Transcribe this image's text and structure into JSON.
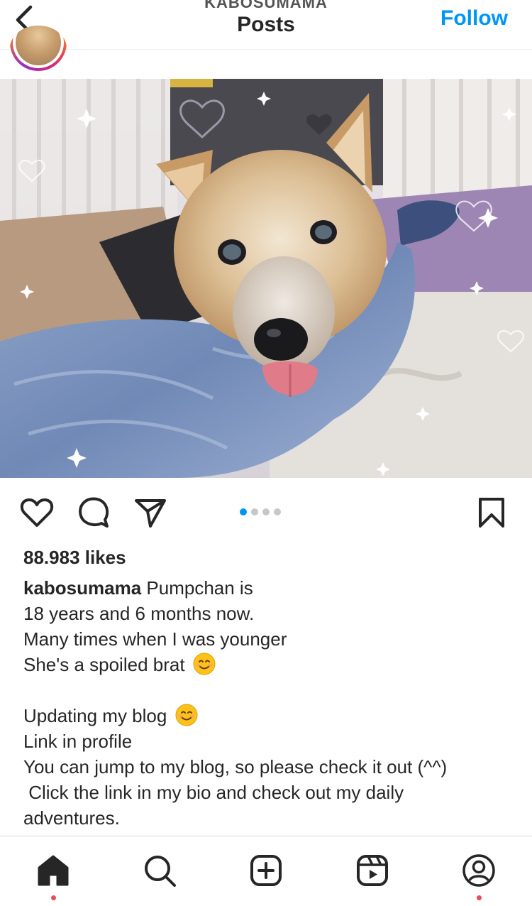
{
  "header": {
    "account_name": "KABOSUMAMA",
    "title": "Posts",
    "follow_label": "Follow",
    "back_icon": "chevron-left-icon"
  },
  "post": {
    "photo_description_icon": "post-photo",
    "carousel": {
      "total": 4,
      "active_index": 0
    },
    "actions": {
      "like_icon": "heart-icon",
      "comment_icon": "comment-icon",
      "share_icon": "share-icon",
      "save_icon": "bookmark-icon"
    },
    "likes": "88.983 likes",
    "caption": {
      "username": "kabosumama",
      "line1_text": " Pumpchan is",
      "line2": "18 years and 6 months now.",
      "line3": "Many times when I was younger",
      "line4": "She's a spoiled brat",
      "line6": "Updating my blog",
      "line7": "Link in profile",
      "line8": "You can jump to my blog, so please check it out (^^)",
      "line9": " Click the link in my bio and check out my daily",
      "line10": "adventures."
    }
  },
  "nav": {
    "items": [
      {
        "name": "home-icon",
        "active": true,
        "notification_dot": true
      },
      {
        "name": "search-icon",
        "active": false,
        "notification_dot": false
      },
      {
        "name": "new-post-icon",
        "active": false,
        "notification_dot": false
      },
      {
        "name": "reels-icon",
        "active": false,
        "notification_dot": false
      },
      {
        "name": "profile-icon",
        "active": false,
        "notification_dot": true
      }
    ]
  },
  "colors": {
    "accent": "#0095f6",
    "notification": "#ed4956",
    "text": "#262626"
  }
}
